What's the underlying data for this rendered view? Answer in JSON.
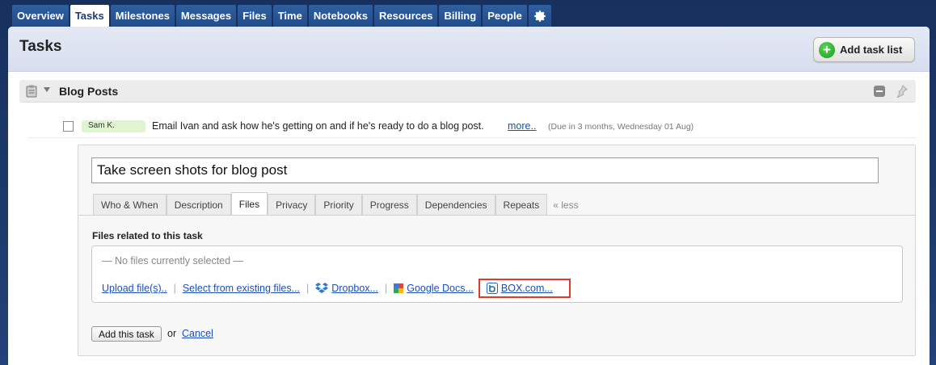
{
  "nav": {
    "tabs": [
      "Overview",
      "Tasks",
      "Milestones",
      "Messages",
      "Files",
      "Time",
      "Notebooks",
      "Resources",
      "Billing",
      "People"
    ],
    "active": "Tasks",
    "settings_icon": "gear-icon"
  },
  "header": {
    "title": "Tasks",
    "add_task_list_label": "Add task list"
  },
  "task_list": {
    "title": "Blog Posts"
  },
  "task": {
    "assignee": "Sam K.",
    "text": "Email Ivan and ask how he's getting on and if he's ready to do a blog post.",
    "more_link": "more..",
    "due": "(Due in 3 months, Wednesday 01 Aug)"
  },
  "form": {
    "title_value": "Take screen shots for blog post",
    "tabs": [
      "Who & When",
      "Description",
      "Files",
      "Privacy",
      "Priority",
      "Progress",
      "Dependencies",
      "Repeats"
    ],
    "active_tab": "Files",
    "less_link": "« less",
    "files_title": "Files related to this task",
    "no_files": "— No files currently selected —",
    "links": {
      "upload": "Upload file(s)..",
      "existing": "Select from existing files...",
      "dropbox": "Dropbox...",
      "google_docs": "Google Docs...",
      "box": "BOX.com..."
    },
    "separator": "|",
    "add_button": "Add this task",
    "or_text": "or",
    "cancel": "Cancel"
  },
  "colors": {
    "nav_bg": "#1d3a6b",
    "highlight": "#e03a2f",
    "link": "#1a4fb8",
    "assignee_bg": "#dff5cf"
  }
}
